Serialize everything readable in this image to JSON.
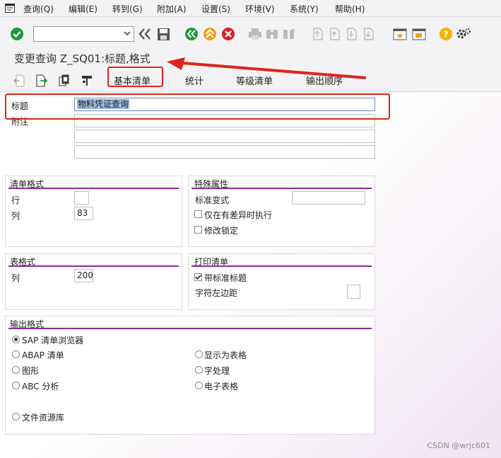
{
  "menu": {
    "query": "查询(Q)",
    "edit": "编辑(E)",
    "goto": "转到(G)",
    "extras": "附加(A)",
    "settings": "设置(S)",
    "environment": "环境(V)",
    "system": "系统(Y)",
    "help": "帮助(H)"
  },
  "command_field": {
    "value": ""
  },
  "title": "变更查询 Z_SQ01:标题,格式",
  "app_tabs": [
    "基本清单",
    "统计",
    "等级清单",
    "输出顺序"
  ],
  "header": {
    "title_label": "标题",
    "title_value": "物料凭证查询",
    "notes_label": "附注"
  },
  "list_format": {
    "title": "清单格式",
    "rows_label": "行",
    "rows_value": "",
    "cols_label": "列",
    "cols_value": "83"
  },
  "special": {
    "title": "特殊属性",
    "std_variant_label": "标准变式",
    "std_variant_value": "",
    "only_diff_label": "仅在有差异时执行",
    "only_diff_checked": false,
    "change_lock_label": "修改锁定",
    "change_lock_checked": false
  },
  "table_format": {
    "title": "表格式",
    "cols_label": "列",
    "cols_value": "200"
  },
  "print_list": {
    "title": "打印清单",
    "with_std_title_label": "带标准标题",
    "with_std_title_checked": true,
    "left_margin_label": "字符左边距",
    "left_margin_value": ""
  },
  "output_format": {
    "title": "输出格式",
    "options": [
      "SAP 清单浏览器",
      "ABAP 清单",
      "图形",
      "ABC 分析",
      "显示为表格",
      "字处理",
      "电子表格",
      "文件资源库"
    ],
    "selected": "SAP 清单浏览器"
  },
  "watermark": "CSDN @wrjc601",
  "colors": {
    "accent": "#8e2a9e",
    "annotation": "#e0231b",
    "ok_green": "#1e9a3c",
    "cancel_red": "#d42027",
    "nav_orange": "#f0a11a",
    "help_yellow": "#f4b400"
  }
}
